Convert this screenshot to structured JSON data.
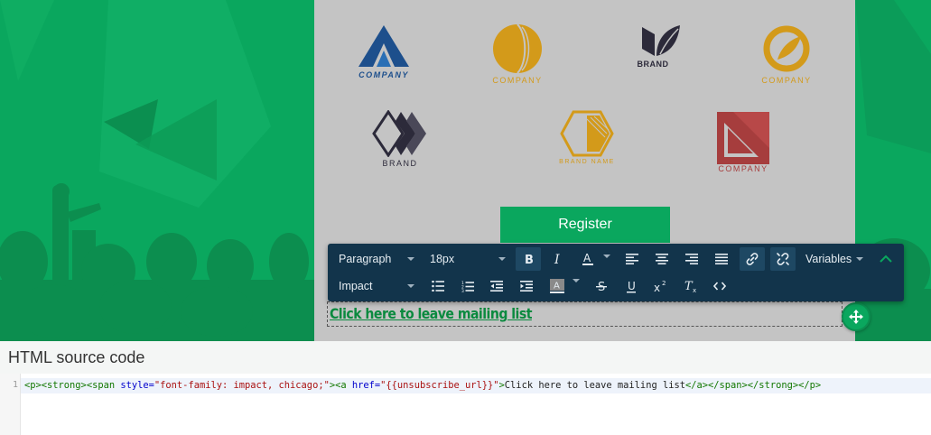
{
  "logos": [
    {
      "label": "COMPANY",
      "color": "#1d4f8c"
    },
    {
      "label": "COMPANY",
      "color": "#d39a1a"
    },
    {
      "label": "BRAND",
      "color": "#2c2a3a"
    },
    {
      "label": "COMPANY",
      "color": "#d39a1a"
    },
    {
      "label": "BRAND",
      "color": "#2c2a3a"
    },
    {
      "label": "BRAND NAME",
      "color": "#d39a1a"
    },
    {
      "label": "COMPANY",
      "color": "#a63d3d"
    }
  ],
  "register_label": "Register",
  "link_text": "Click here to leave mailing list",
  "toolbar": {
    "block_format": "Paragraph",
    "font_size": "18px",
    "font_family": "Impact",
    "variables_label": "Variables",
    "icons": {
      "bold": "bold-icon",
      "italic": "italic-icon",
      "text_color": "text-color-icon",
      "align_left": "align-left-icon",
      "align_center": "align-center-icon",
      "align_right": "align-right-icon",
      "align_justify": "align-justify-icon",
      "link": "link-icon",
      "unlink": "unlink-icon",
      "collapse": "chevron-up-icon",
      "bullet_list": "bullet-list-icon",
      "numbered_list": "numbered-list-icon",
      "outdent": "outdent-icon",
      "indent": "indent-icon",
      "background_color": "background-color-icon",
      "strikethrough": "strikethrough-icon",
      "underline": "underline-icon",
      "superscript": "superscript-icon",
      "clear_format": "clear-formatting-icon",
      "source_code": "code-icon"
    }
  },
  "source": {
    "title": "HTML source code",
    "line_number": "1",
    "code": {
      "t1": "<p><strong><span ",
      "a1": "style=",
      "s1": "\"font-family: impact, chicago;\"",
      "t2": "><a ",
      "a2": "href=",
      "s2": "\"{{unsubscribe_url}}\"",
      "t3": ">",
      "txt": "Click here to leave mailing list",
      "t4": "</a></span></strong></p>"
    }
  },
  "colors": {
    "canvas_bg": "#0aa75e",
    "panel_bg": "#c4c4c4",
    "toolbar_bg": "#12344b",
    "link": "#0a8a3f"
  }
}
